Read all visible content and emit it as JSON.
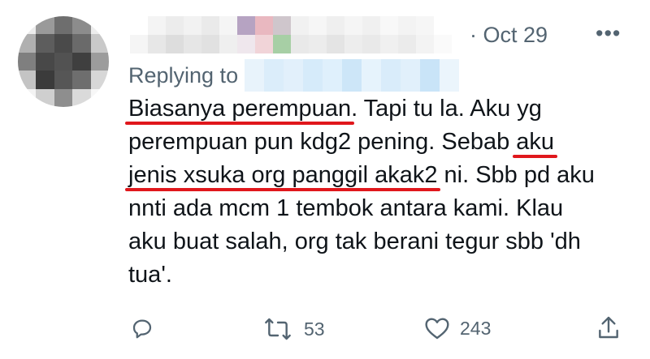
{
  "tweet": {
    "date": "· Oct 29",
    "more_label": "•••",
    "replying_to_label": "Replying to",
    "text_lines": [
      [
        {
          "t": "Biasanya perempuan",
          "u": true
        },
        {
          "t": ". Tapi tu la. Aku yg",
          "u": false
        }
      ],
      [
        {
          "t": "perempuan pun kdg2 pening. Sebab ",
          "u": false
        },
        {
          "t": "aku",
          "u": true
        }
      ],
      [
        {
          "t": "jenis xsuka org panggil akak2",
          "u": true
        },
        {
          "t": " ni. Sbb pd aku",
          "u": false
        }
      ],
      [
        {
          "t": "nnti ada mcm 1 tembok antara kami. Klau",
          "u": false
        }
      ],
      [
        {
          "t": "aku buat salah, org tak berani tegur sbb 'dh",
          "u": false
        }
      ],
      [
        {
          "t": "tua'.",
          "u": false
        }
      ]
    ]
  },
  "actions": {
    "reply": {
      "icon": "reply-icon",
      "count": ""
    },
    "retweet": {
      "icon": "retweet-icon",
      "count": "53"
    },
    "like": {
      "icon": "heart-icon",
      "count": "243"
    },
    "share": {
      "icon": "share-icon",
      "count": ""
    }
  },
  "colors": {
    "text": "#0f1419",
    "secondary": "#536471",
    "underline": "#e0171c"
  }
}
